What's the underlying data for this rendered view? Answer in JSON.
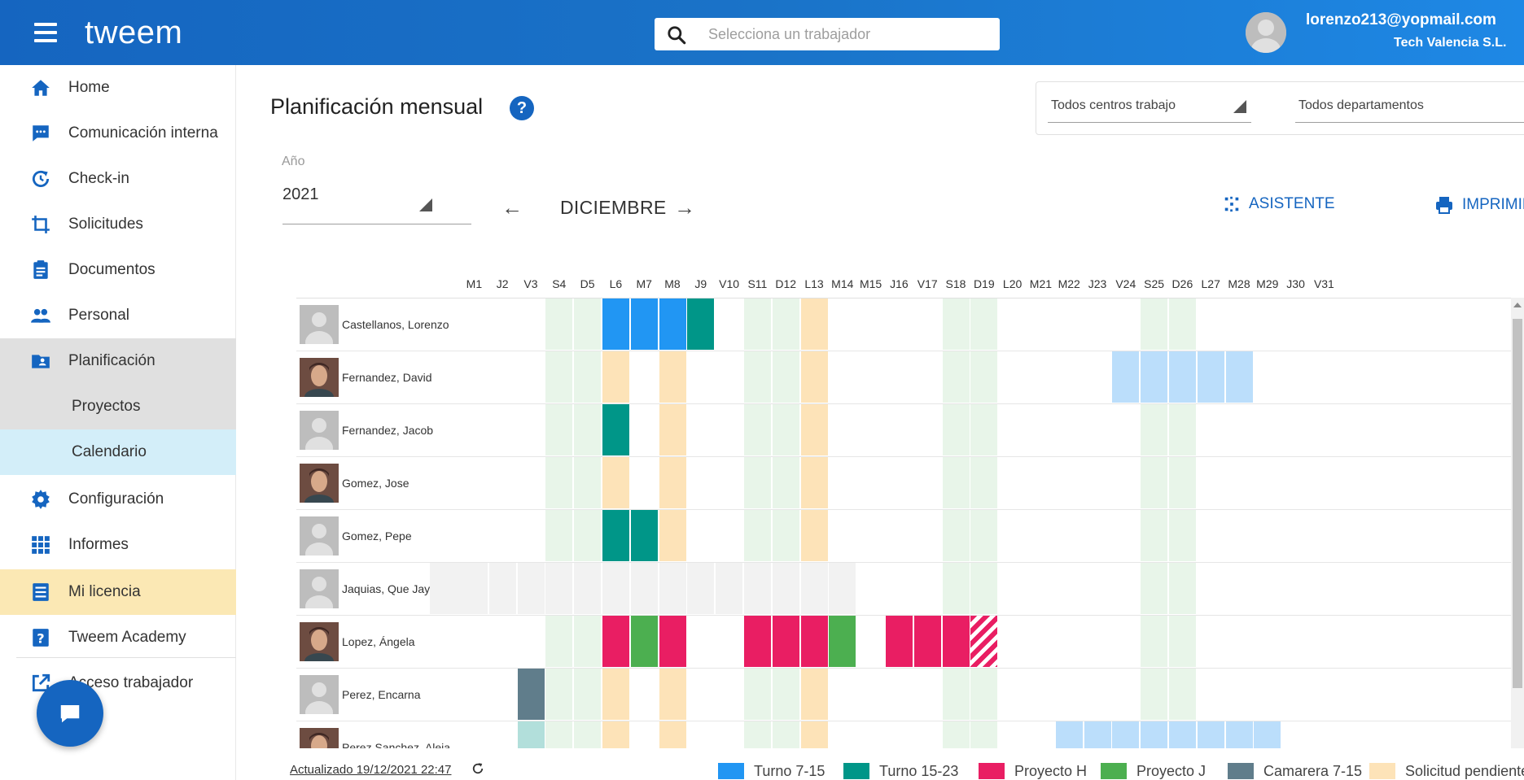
{
  "topbar": {
    "brand": "tweem",
    "search_placeholder": "Selecciona un trabajador",
    "user_email": "lorenzo213@yopmail.com",
    "user_company": "Tech Valencia S.L."
  },
  "sidebar": {
    "items": [
      {
        "key": "home",
        "label": "Home",
        "icon": "home-icon"
      },
      {
        "key": "comunicacion",
        "label": "Comunicación interna",
        "icon": "chat-bubble-icon"
      },
      {
        "key": "checkin",
        "label": "Check-in",
        "icon": "clock-refresh-icon"
      },
      {
        "key": "solicitudes",
        "label": "Solicitudes",
        "icon": "crop-icon"
      },
      {
        "key": "documentos",
        "label": "Documentos",
        "icon": "clipboard-icon"
      },
      {
        "key": "personal",
        "label": "Personal",
        "icon": "people-icon"
      },
      {
        "key": "planificacion",
        "label": "Planificación",
        "icon": "folder-user-icon"
      },
      {
        "key": "proyectos",
        "label": "Proyectos",
        "icon": ""
      },
      {
        "key": "calendario",
        "label": "Calendario",
        "icon": ""
      },
      {
        "key": "configuracion",
        "label": "Configuración",
        "icon": "gear-icon"
      },
      {
        "key": "informes",
        "label": "Informes",
        "icon": "grid-icon"
      },
      {
        "key": "licencia",
        "label": "Mi licencia",
        "icon": "list-box-icon"
      },
      {
        "key": "academy",
        "label": "Tweem Academy",
        "icon": "question-box-icon"
      },
      {
        "key": "acceso",
        "label": "Acceso trabajador",
        "icon": "external-link-icon"
      }
    ]
  },
  "main": {
    "title": "Planificación mensual",
    "filters": {
      "centros": "Todos centros trabajo",
      "departamentos": "Todos departamentos"
    },
    "year_label": "Año",
    "year_value": "2021",
    "month": "DICIEMBRE",
    "assistant_label": "ASISTENTE",
    "print_label": "IMPRIMIR"
  },
  "calendar": {
    "days": [
      "M1",
      "J2",
      "V3",
      "S4",
      "D5",
      "L6",
      "M7",
      "M8",
      "J9",
      "V10",
      "S11",
      "D12",
      "L13",
      "M14",
      "M15",
      "J16",
      "V17",
      "S18",
      "D19",
      "L20",
      "M21",
      "M22",
      "J23",
      "V24",
      "S25",
      "D26",
      "L27",
      "M28",
      "M29",
      "J30",
      "V31"
    ],
    "weekend_days": [
      4,
      5,
      11,
      12,
      18,
      19,
      25,
      26
    ],
    "colors": {
      "turno715": "#2196f3",
      "turno1523": "#009688",
      "proyectoH": "#e91e63",
      "proyectoJ": "#4caf50",
      "camarera": "#607d8b",
      "pendiente": "#fde3b8",
      "vacaciones": "#bbdefb",
      "weekend": "#e8f5e9",
      "inactive": "#f2f2f2",
      "camarera_pend": "#b2dfdb"
    },
    "employees": [
      {
        "name": "Castellanos, Lorenzo",
        "photo": "placeholder",
        "cells": [
          [
            6,
            "turno715"
          ],
          [
            7,
            "turno715"
          ],
          [
            8,
            "turno715"
          ],
          [
            9,
            "turno1523"
          ],
          [
            13,
            "pendiente"
          ]
        ]
      },
      {
        "name": "Fernandez, David",
        "photo": "photo",
        "cells": [
          [
            6,
            "pendiente"
          ],
          [
            8,
            "pendiente"
          ],
          [
            13,
            "pendiente"
          ],
          [
            24,
            "vacaciones"
          ],
          [
            25,
            "vacaciones"
          ],
          [
            26,
            "vacaciones"
          ],
          [
            27,
            "vacaciones"
          ],
          [
            28,
            "vacaciones"
          ]
        ]
      },
      {
        "name": "Fernandez, Jacob",
        "photo": "placeholder",
        "cells": [
          [
            6,
            "turno1523"
          ],
          [
            8,
            "pendiente"
          ],
          [
            13,
            "pendiente"
          ]
        ]
      },
      {
        "name": "Gomez, Jose",
        "photo": "photo",
        "cells": [
          [
            6,
            "pendiente"
          ],
          [
            8,
            "pendiente"
          ],
          [
            13,
            "pendiente"
          ]
        ]
      },
      {
        "name": "Gomez, Pepe",
        "photo": "placeholder",
        "cells": [
          [
            6,
            "turno1523"
          ],
          [
            7,
            "turno1523"
          ],
          [
            8,
            "pendiente"
          ],
          [
            13,
            "pendiente"
          ]
        ]
      },
      {
        "name": "Jaquias, Que Jay",
        "photo": "placeholder",
        "inactive_until": 14,
        "cells": []
      },
      {
        "name": "Lopez, Ángela",
        "photo": "photo",
        "cells": [
          [
            6,
            "proyectoH"
          ],
          [
            7,
            "proyectoJ"
          ],
          [
            8,
            "proyectoH"
          ],
          [
            11,
            "proyectoH"
          ],
          [
            12,
            "proyectoH"
          ],
          [
            13,
            "proyectoH"
          ],
          [
            14,
            "proyectoJ"
          ],
          [
            16,
            "proyectoH"
          ],
          [
            17,
            "proyectoH"
          ],
          [
            18,
            "proyectoH"
          ],
          [
            19,
            "proyectoH_pend"
          ]
        ]
      },
      {
        "name": "Perez, Encarna",
        "photo": "placeholder",
        "cells": [
          [
            3,
            "camarera"
          ],
          [
            6,
            "pendiente"
          ],
          [
            8,
            "pendiente"
          ],
          [
            13,
            "pendiente"
          ]
        ]
      },
      {
        "name": "Perez Sanchez, Aleja...",
        "photo": "photo",
        "cells": [
          [
            3,
            "camarera_pend"
          ],
          [
            6,
            "pendiente"
          ],
          [
            8,
            "pendiente"
          ],
          [
            13,
            "pendiente"
          ],
          [
            22,
            "vacaciones"
          ],
          [
            23,
            "vacaciones"
          ],
          [
            24,
            "vacaciones"
          ],
          [
            25,
            "vacaciones"
          ],
          [
            26,
            "vacaciones"
          ],
          [
            27,
            "vacaciones"
          ],
          [
            28,
            "vacaciones"
          ],
          [
            29,
            "vacaciones"
          ]
        ]
      }
    ]
  },
  "footer": {
    "updated": "Actualizado 19/12/2021 22:47",
    "legend": [
      {
        "label": "Turno 7-15",
        "color": "#2196f3"
      },
      {
        "label": "Turno 15-23",
        "color": "#009688"
      },
      {
        "label": "Proyecto H",
        "color": "#e91e63"
      },
      {
        "label": "Proyecto J",
        "color": "#4caf50"
      },
      {
        "label": "Camarera 7-15",
        "color": "#607d8b"
      },
      {
        "label": "Solicitud pendiente",
        "color": "#fde3b8"
      }
    ]
  }
}
